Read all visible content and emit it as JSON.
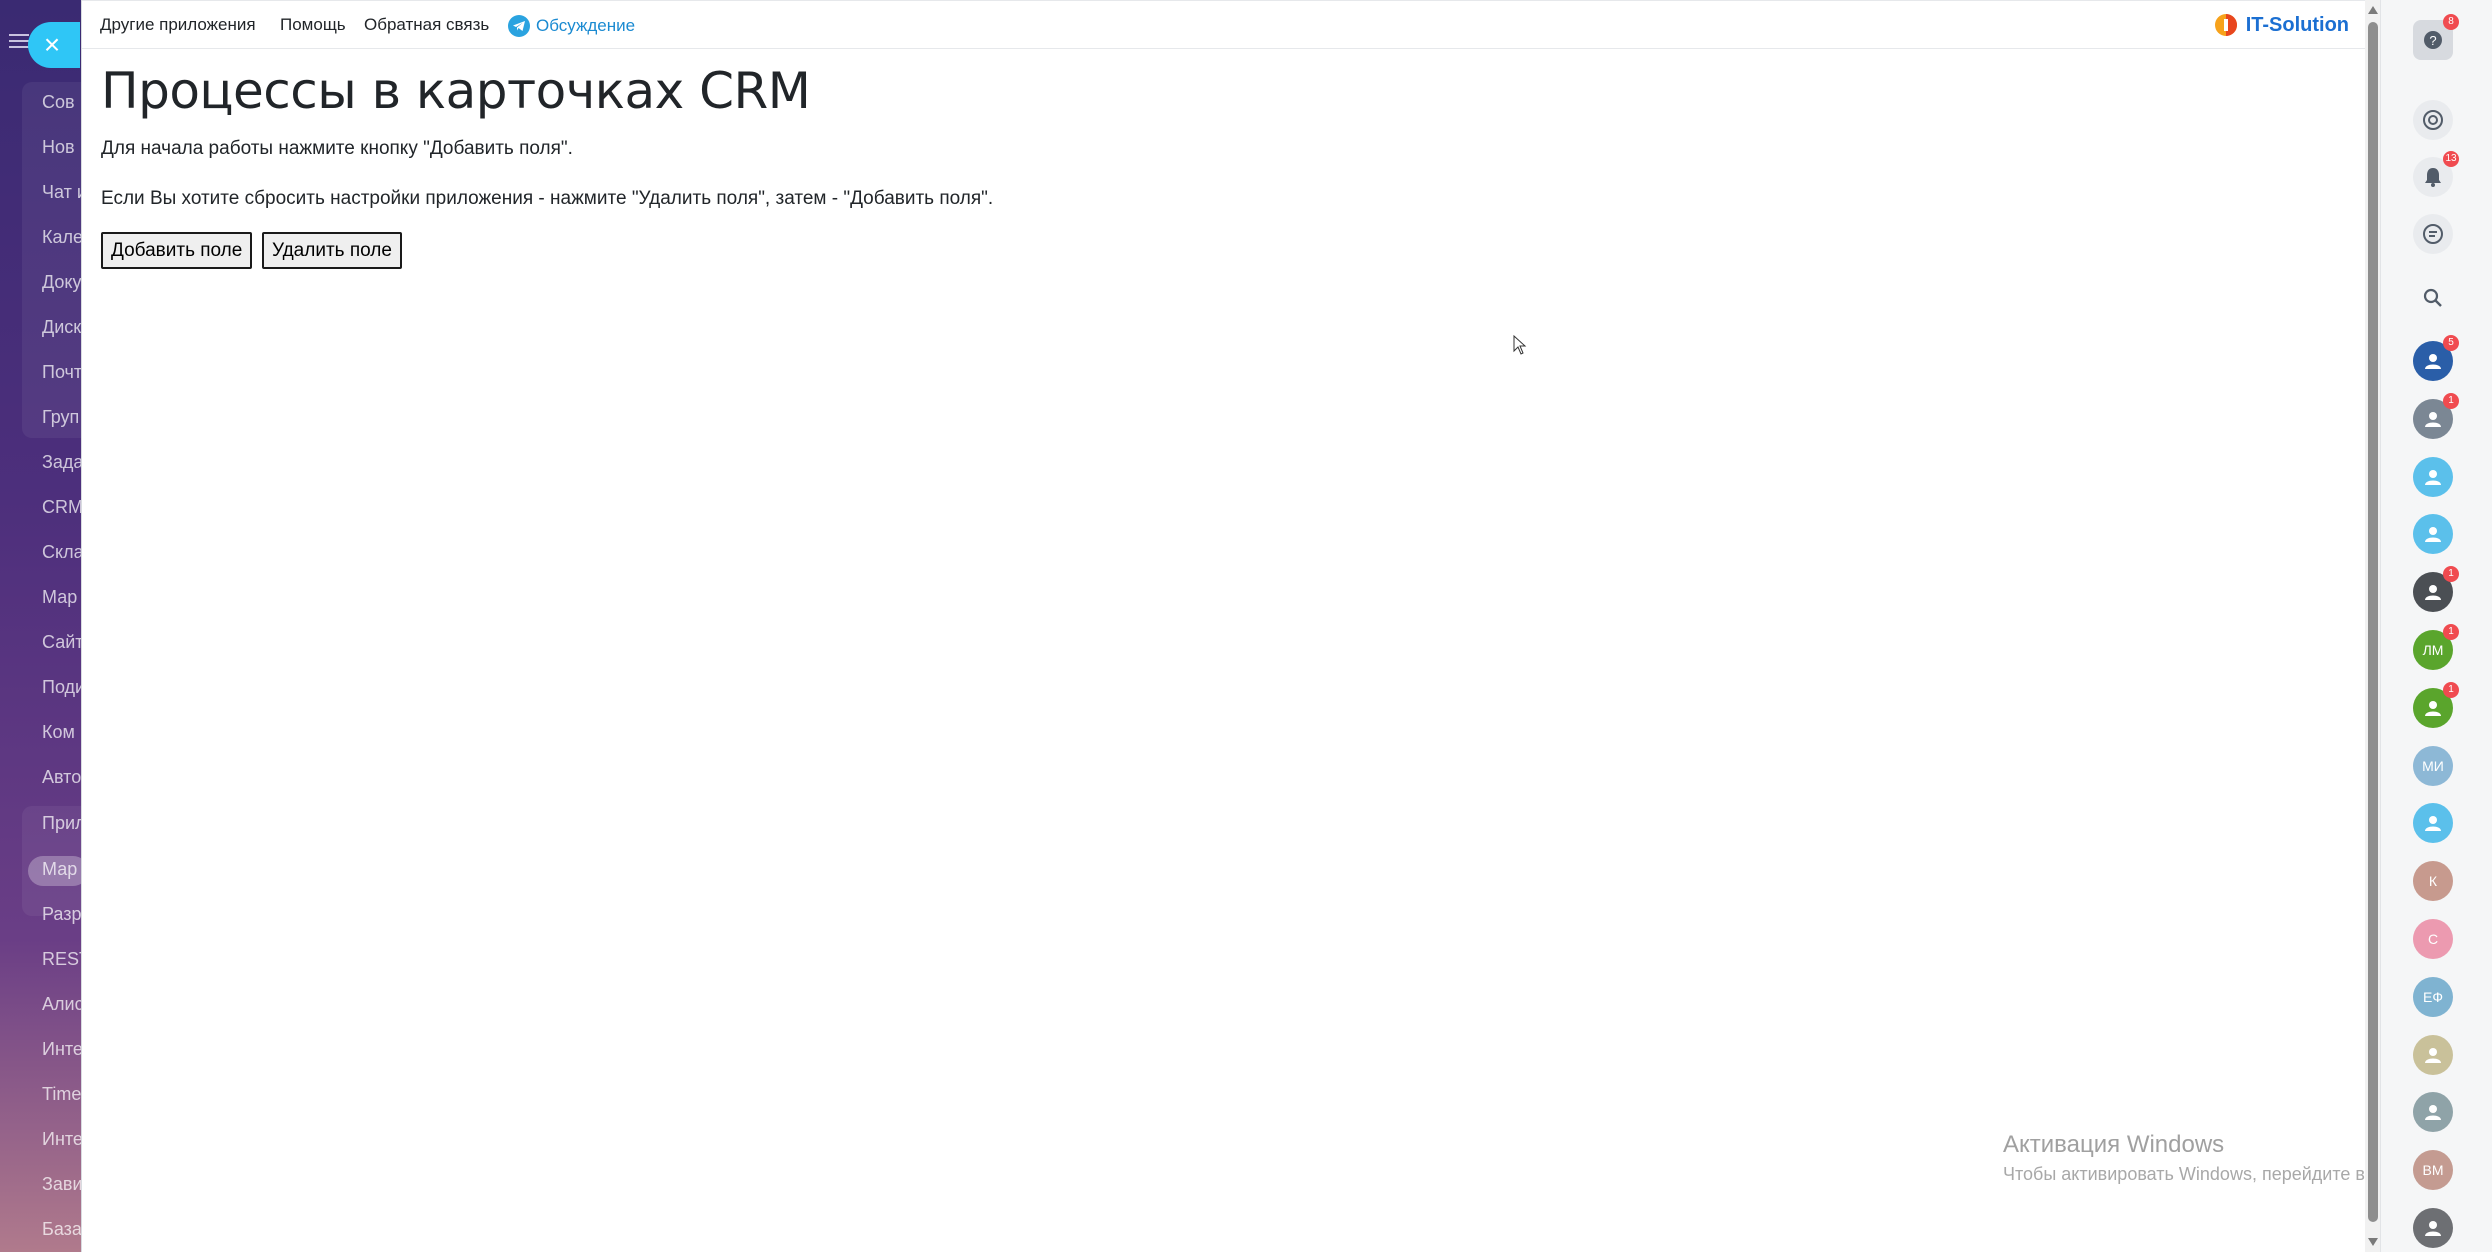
{
  "sidebar": {
    "items": [
      "Сов",
      "Нов",
      "Чат и",
      "Кале",
      "Доку",
      "Диск",
      "Почт",
      "Груп",
      "Зада",
      "CRM",
      "Скла",
      "Мар",
      "Сайт",
      "Поди",
      "Ком",
      "Авто",
      "Прил",
      "Мар",
      "Разр",
      "REST",
      "Алис",
      "Инте",
      "Time",
      "Инте",
      "Зави",
      "База"
    ]
  },
  "close_button": {
    "icon": "close-icon",
    "label": "×"
  },
  "topnav": {
    "other_apps": "Другие приложения",
    "help": "Помощь",
    "feedback": "Обратная связь",
    "discussion": "Обсуждение",
    "brand": "IT-Solution"
  },
  "main": {
    "title": "Процессы в карточках CRM",
    "intro": "Для начала работы нажмите кнопку \"Добавить поля\".",
    "reset_hint": "Если Вы хотите сбросить настройки приложения - нажмите \"Удалить поля\", затем - \"Добавить поля\".",
    "add_button": "Добавить поле",
    "delete_button": "Удалить поле"
  },
  "watermark": {
    "title": "Активация Windows",
    "text": "Чтобы активировать Windows, перейдите в раздел \"Параметры\"."
  },
  "right_panel": {
    "help_badge": "8",
    "notifications_badge": "13",
    "chats": [
      {
        "initials": "",
        "badge": "5",
        "color": "#2a5ea8"
      },
      {
        "initials": "",
        "badge": "1",
        "color": "#7b8794"
      },
      {
        "initials": "",
        "badge": "",
        "color": "#5bc0eb"
      },
      {
        "initials": "",
        "badge": "",
        "color": "#5bc0eb"
      },
      {
        "initials": "",
        "badge": "1",
        "color": "#4b4f54"
      },
      {
        "initials": "ЛМ",
        "badge": "1",
        "color": "#5aa52c"
      },
      {
        "initials": "",
        "badge": "1",
        "color": "#5aa52c"
      },
      {
        "initials": "МИ",
        "badge": "",
        "color": "#8db8d6"
      },
      {
        "initials": "",
        "badge": "",
        "color": "#5bc0eb"
      },
      {
        "initials": "К",
        "badge": "",
        "color": "#c79a8e"
      },
      {
        "initials": "С",
        "badge": "",
        "color": "#ec9ab0"
      },
      {
        "initials": "ЕФ",
        "badge": "",
        "color": "#7fb3d1"
      },
      {
        "initials": "",
        "badge": "",
        "color": "#c9c19a"
      },
      {
        "initials": "",
        "badge": "",
        "color": "#8fa3a8"
      },
      {
        "initials": "ВМ",
        "badge": "",
        "color": "#c49b91"
      },
      {
        "initials": "",
        "badge": "",
        "color": "#6d6f73"
      }
    ]
  }
}
